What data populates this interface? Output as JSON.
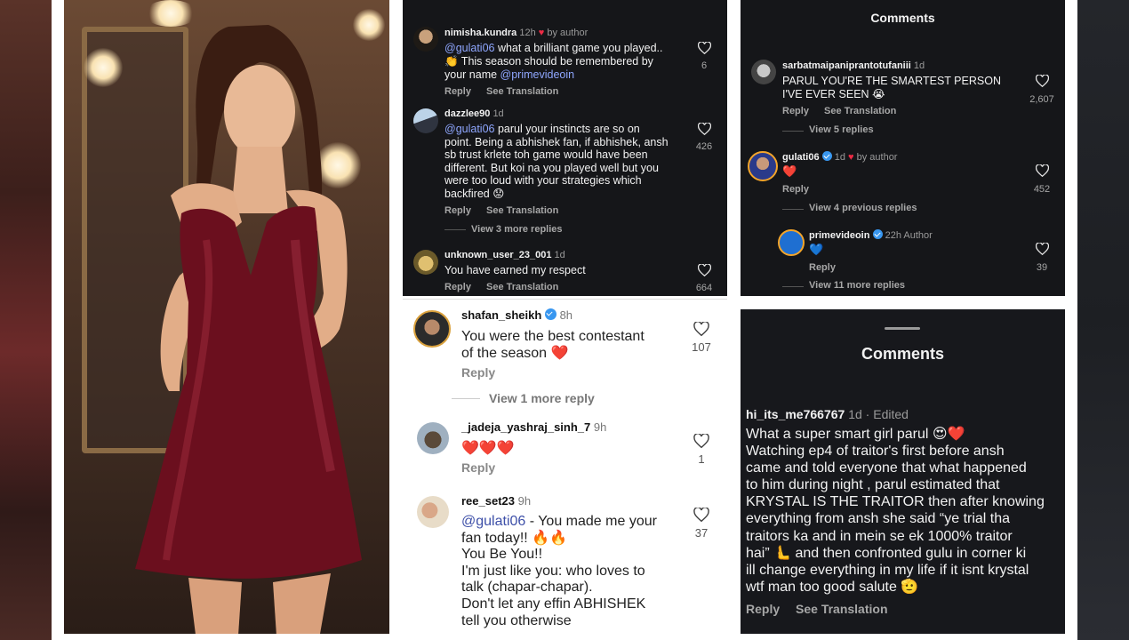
{
  "panel_top_left": {
    "comments": [
      {
        "username": "nimisha.kundra",
        "time": "12h",
        "by_author": "by author",
        "mention": "@gulati06",
        "text_a": " what a brilliant game you played..",
        "text_b": "👏 This season should be remembered by",
        "text_c": "your name ",
        "mention2": "@primevideoin",
        "reply": "Reply",
        "translate": "See Translation",
        "likes": "6"
      },
      {
        "username": "dazzlee90",
        "time": "1d",
        "mention": "@gulati06",
        "text_a": " parul your instincts are so on",
        "lines": [
          "point. Being a abhishek fan, if abhishek, ansh",
          "sb  trust krlete toh game would have been",
          "different. But koi na you played well but you",
          "were too loud with your strategies which",
          "backfired 😟"
        ],
        "reply": "Reply",
        "translate": "See Translation",
        "likes": "426",
        "more_replies": "View 3 more replies"
      },
      {
        "username": "unknown_user_23_001",
        "time": "1d",
        "text": "You have earned my respect",
        "reply": "Reply",
        "translate": "See Translation",
        "likes": "664"
      }
    ]
  },
  "panel_top_right": {
    "header": "Comments",
    "comments": [
      {
        "username": "sarbatmaipaniprantotufaniii",
        "time": "1d",
        "lines": [
          "PARUL YOU'RE THE SMARTEST PERSON",
          "I'VE EVER SEEN 😭"
        ],
        "reply": "Reply",
        "translate": "See Translation",
        "likes": "2,607",
        "more_replies": "View 5 replies"
      },
      {
        "username": "gulati06",
        "time": "1d",
        "by_author": "by author",
        "text": "❤️",
        "reply": "Reply",
        "likes": "452",
        "more_replies": "View 4 previous replies"
      },
      {
        "username": "primevideoin",
        "time": "22h",
        "author_tag": "Author",
        "text": "💙",
        "reply": "Reply",
        "likes": "39",
        "more_replies": "View 11 more replies"
      }
    ]
  },
  "panel_bottom_left": {
    "comments": [
      {
        "username": "shafan_sheikh",
        "time": "8h",
        "lines": [
          "You were the best contestant",
          "of the season ❤️"
        ],
        "reply": "Reply",
        "likes": "107",
        "more_replies": "View 1 more reply"
      },
      {
        "username": "_jadeja_yashraj_sinh_7",
        "time": "9h",
        "text": "❤️❤️❤️",
        "reply": "Reply",
        "likes": "1"
      },
      {
        "username": "ree_set23",
        "time": "9h",
        "mention": "@gulati06",
        "text_a": " - You made me your",
        "lines": [
          "fan today!! 🔥🔥",
          "You Be You!!",
          "I'm just like you: who loves to",
          "talk (chapar-chapar).",
          "Don't let any effin ABHISHEK",
          "tell you otherwise"
        ],
        "likes": "37"
      }
    ]
  },
  "panel_bottom_right": {
    "header": "Comments",
    "comment": {
      "username": "hi_its_me766767",
      "time": "1d",
      "edited": "Edited",
      "lines": [
        "What a super smart girl parul 😍❤️",
        "Watching ep4 of traitor's first before ansh",
        "came and told everyone that what happened",
        "to him during night , parul estimated that",
        "KRYSTAL IS THE TRAITOR then after knowing",
        "everything from ansh she said “ye trial tha",
        "traitors ka and in mein se ek 1000% traitor",
        "hai” 🫷 and then confronted gulu in corner ki",
        "ill change everything in my life if it isnt krystal",
        "wtf man too good salute 🫡"
      ],
      "reply": "Reply",
      "translate": "See Translation"
    }
  },
  "colors": {
    "dark_bg": "#151619",
    "heart_red": "#ed2b45",
    "mention_blue": "#8fa7ff",
    "verified_blue": "#3897f0"
  },
  "icons": [
    "heart-outline-icon",
    "verified-badge-icon",
    "red-heart-icon"
  ]
}
